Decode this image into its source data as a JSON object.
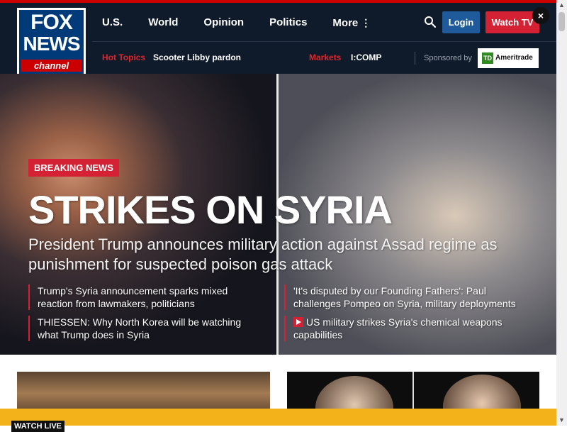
{
  "header": {
    "logo": {
      "line1": "FOX",
      "line2": "NEWS",
      "line3": "channel"
    },
    "nav": [
      "U.S.",
      "World",
      "Opinion",
      "Politics",
      "More"
    ],
    "more_icon": "⋮",
    "login_label": "Login",
    "watch_label": "Watch TV",
    "hot_topics_label": "Hot Topics",
    "hot_topic": "Scooter Libby pardon",
    "markets_label": "Markets",
    "market_value": "I:COMP",
    "sponsored_label": "Sponsored by",
    "sponsor_mark": "TD",
    "sponsor_name": "Ameritrade"
  },
  "hero": {
    "badge": "BREAKING NEWS",
    "headline": "STRIKES ON SYRIA",
    "deck": "President Trump announces military action against Assad regime as punishment for suspected poison gas attack",
    "stories": [
      "Trump's Syria announcement sparks mixed reaction from lawmakers, politicians",
      "THIESSEN: Why North Korea will be watching what Trump does in Syria",
      "'It's disputed by our Founding Fathers': Paul challenges Pompeo on Syria, military deployments",
      "US military strikes Syria's chemical weapons capabilities"
    ]
  },
  "live_bar": {
    "label": "WATCH LIVE",
    "close_icon": "×"
  },
  "colors": {
    "header_bg": "#0f1a2a",
    "brand_red": "#d42234",
    "login_blue": "#1f5b9a",
    "live_bar": "#f3b21a"
  }
}
